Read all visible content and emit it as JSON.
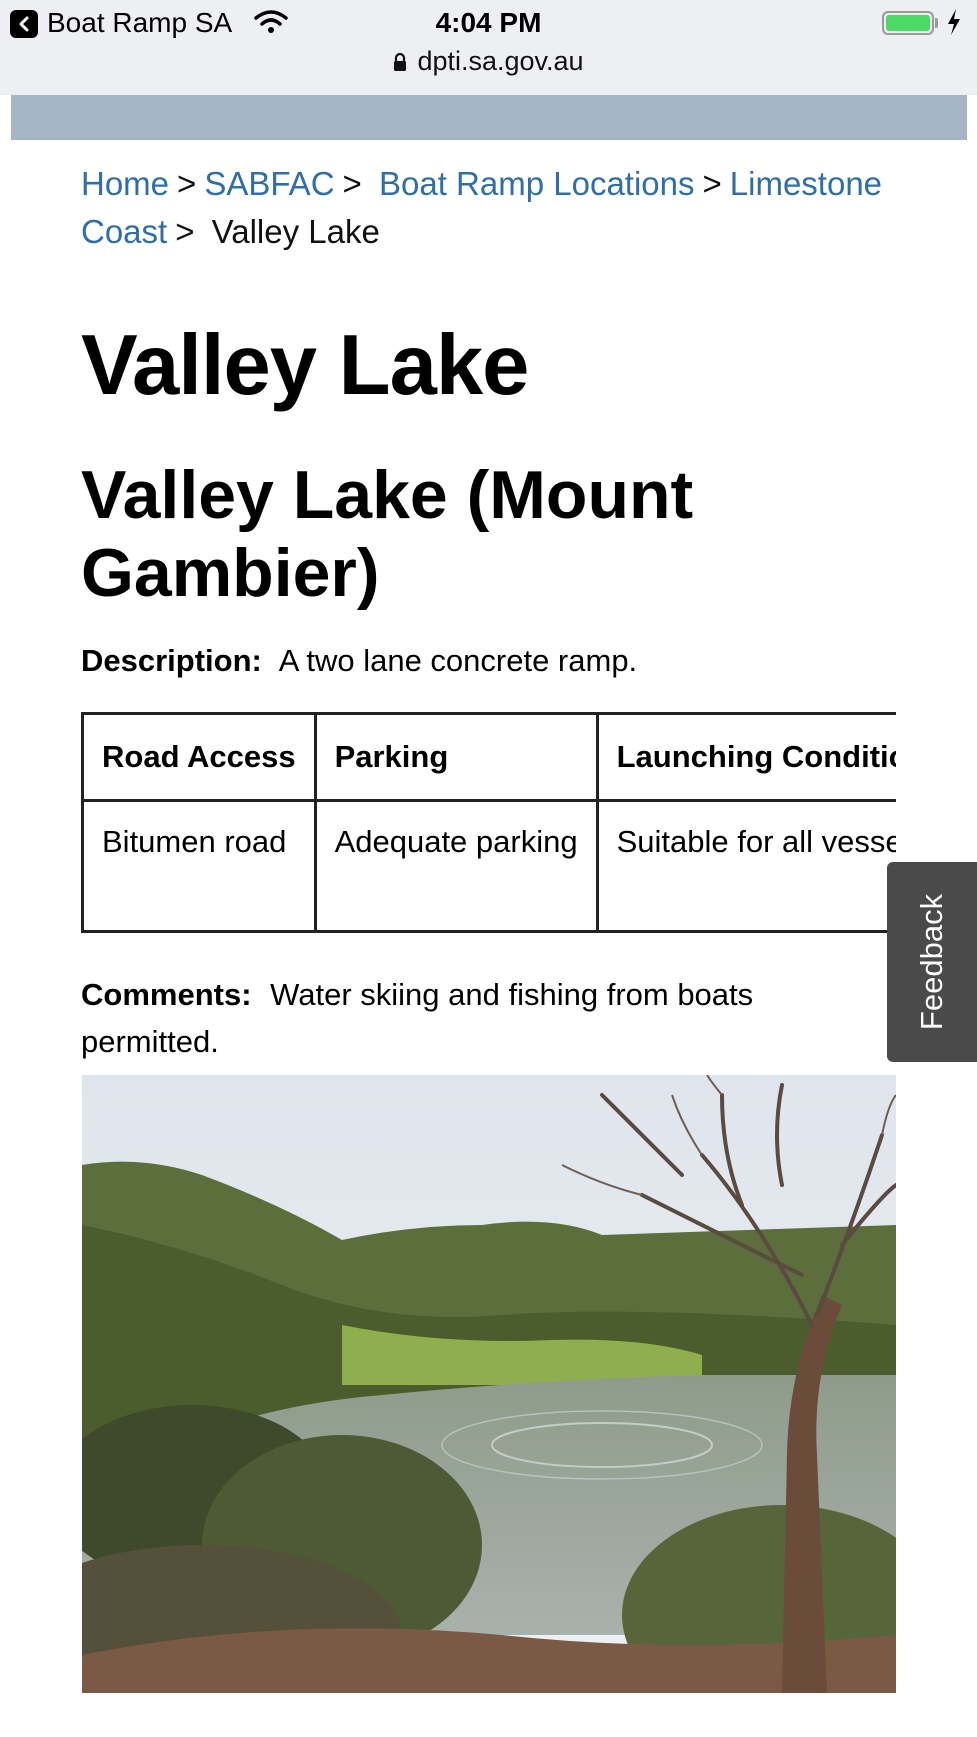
{
  "status_bar": {
    "back_app": "Boat Ramp SA",
    "time": "4:04 PM",
    "url": "dpti.sa.gov.au"
  },
  "breadcrumb": {
    "items": [
      "Home",
      "SABFAC",
      "Boat Ramp Locations",
      "Limestone Coast"
    ],
    "current": "Valley Lake",
    "separator": ">"
  },
  "page": {
    "title": "Valley Lake",
    "subtitle": "Valley Lake (Mount Gambier)",
    "description_label": "Description:",
    "description": "A two lane concrete ramp.",
    "comments_label": "Comments:",
    "comments": "Water skiing and fishing from boats permitted."
  },
  "table": {
    "headers": [
      "Road Access",
      "Parking",
      "Launching Conditions"
    ],
    "rows": [
      [
        "Bitumen road",
        "Adequate parking",
        "Suitable for all vessels"
      ]
    ]
  },
  "feedback_tab": {
    "label": "Feedback"
  },
  "colors": {
    "link": "#2f6ea8",
    "header_band": "#a6b5c7",
    "feedback_bg": "#4a4a4a"
  },
  "icons": [
    "back-icon",
    "wifi-icon",
    "battery-icon",
    "charging-bolt-icon",
    "lock-icon"
  ]
}
